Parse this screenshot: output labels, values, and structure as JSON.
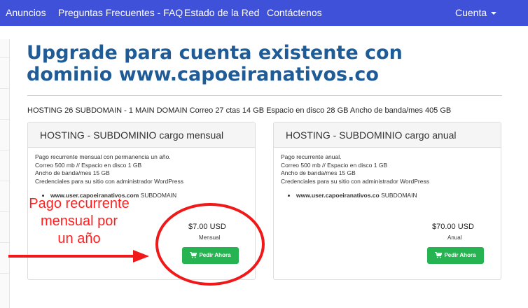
{
  "nav": {
    "items": [
      "Anuncios",
      "Preguntas Frecuentes - FAQ",
      "Estado de la Red",
      "Contáctenos"
    ],
    "account": "Cuenta"
  },
  "page": {
    "title_line1": "Upgrade para cuenta existente con",
    "title_line2": "dominio www.capoeiranativos.co",
    "summary": "HOSTING 26 SUBDOMAIN - 1 MAIN DOMAIN Correo 27 ctas 14 GB Espacio en disco 28 GB Ancho de banda/mes 405 GB"
  },
  "plans": [
    {
      "title": "HOSTING - SUBDOMINIO cargo mensual",
      "desc": [
        "Pago recurrente mensual con permanencia un año.",
        "Correo 500 mb // Espacio en disco 1 GB",
        "Ancho de banda/mes 15 GB",
        "Credenciales para su sitio con administrador WordPress"
      ],
      "domain": "www.user.capoeiranativos.com",
      "domain_suffix": "SUBDOMAIN",
      "price": "$7.00 USD",
      "cycle": "Mensual",
      "button": "Pedir Ahora"
    },
    {
      "title": "HOSTING - SUBDOMINIO cargo anual",
      "desc": [
        "Pago recurrente anual.",
        "Correo 500 mb // Espacio en disco 1 GB",
        "Ancho de banda/mes 15 GB",
        "Credenciales para su sitio con administrador WordPress"
      ],
      "domain": "www.user.capoeiranativos.co",
      "domain_suffix": "SUBDOMAIN",
      "price": "$70.00 USD",
      "cycle": "Anual",
      "button": "Pedir Ahora"
    }
  ],
  "annotation": {
    "lines": [
      "Pago recurrente",
      "mensual por",
      "un año"
    ],
    "color": "#FF1F1F"
  },
  "colors": {
    "navbar": "#3F51D8",
    "title": "#1F5C97",
    "button": "#26B351"
  }
}
